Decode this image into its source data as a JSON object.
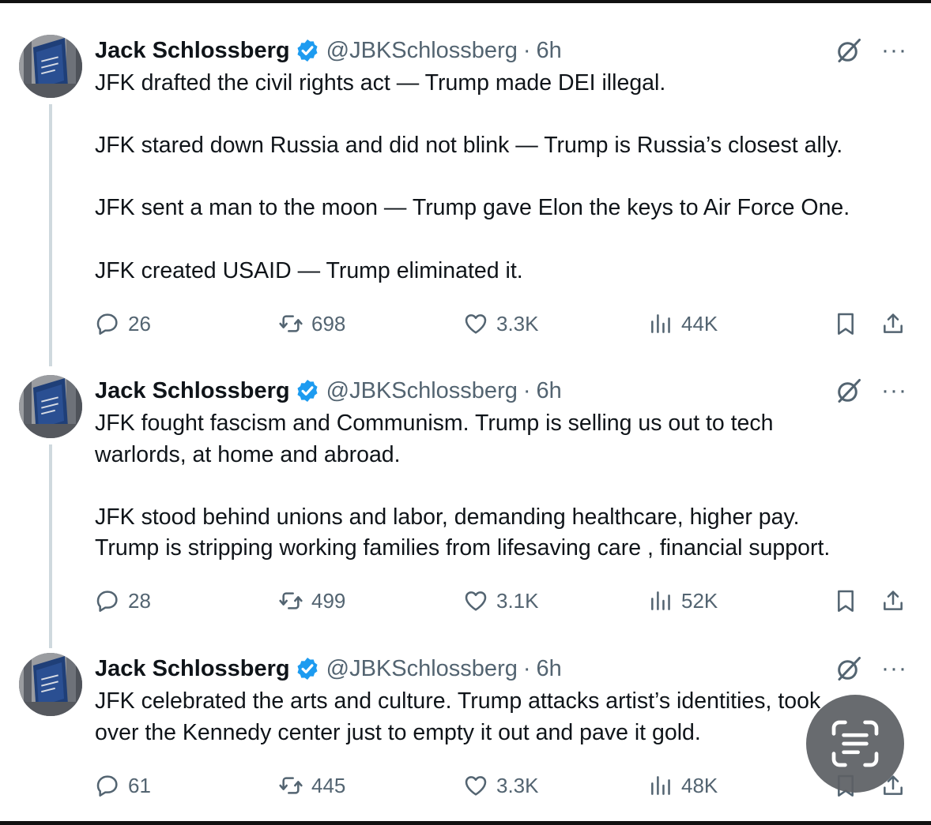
{
  "colors": {
    "text": "#0f1419",
    "secondary": "#536471",
    "verified": "#1d9bf0",
    "thread_line": "#cfd9de"
  },
  "tweets": [
    {
      "author": "Jack Schlossberg",
      "handle": "@JBKSchlossberg",
      "separator": "·",
      "time": "6h",
      "more": "···",
      "lines": [
        "JFK drafted the civil rights act — Trump made DEI illegal.",
        "",
        "JFK stared down Russia and did not blink — Trump is Russia’s closest ally.",
        "",
        "JFK sent a man to the moon — Trump gave Elon the keys to Air Force One.",
        "",
        "JFK created USAID — Trump eliminated it."
      ],
      "replies": "26",
      "reposts": "698",
      "likes": "3.3K",
      "views": "44K"
    },
    {
      "author": "Jack Schlossberg",
      "handle": "@JBKSchlossberg",
      "separator": "·",
      "time": "6h",
      "more": "···",
      "lines": [
        "JFK fought fascism and Communism. Trump is selling us out to tech",
        "warlords, at home and abroad.",
        "",
        "JFK stood behind unions and labor, demanding healthcare, higher pay.",
        "Trump is stripping working families from lifesaving care , financial support."
      ],
      "replies": "28",
      "reposts": "499",
      "likes": "3.1K",
      "views": "52K"
    },
    {
      "author": "Jack Schlossberg",
      "handle": "@JBKSchlossberg",
      "separator": "·",
      "time": "6h",
      "more": "···",
      "lines": [
        "JFK celebrated the arts and culture. Trump attacks artist’s identities, took",
        "over the Kennedy center just to empty it out and pave it gold."
      ],
      "replies": "61",
      "reposts": "445",
      "likes": "3.3K",
      "views": "48K"
    }
  ],
  "icons": {
    "verified": "verified-badge-icon",
    "grok": "grok-icon",
    "reply": "reply-icon",
    "repost": "repost-icon",
    "like": "heart-icon",
    "views": "views-icon",
    "bookmark": "bookmark-icon",
    "share": "share-icon",
    "scanner": "text-scan-icon"
  }
}
